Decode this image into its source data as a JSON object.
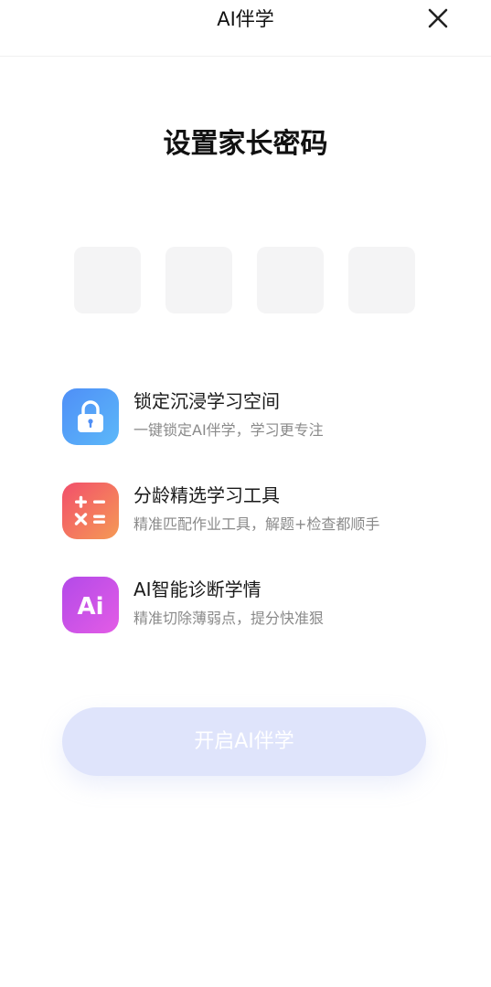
{
  "header": {
    "title": "AI伴学",
    "close_icon": "close-icon"
  },
  "page_title": "设置家长密码",
  "pin": {
    "length": 4,
    "filled": 0
  },
  "features": [
    {
      "icon": "lock-icon",
      "title": "锁定沉浸学习空间",
      "desc": "一键锁定AI伴学，学习更专注",
      "color": "#4f8ff7"
    },
    {
      "icon": "calculator-icon",
      "title": "分龄精选学习工具",
      "desc": "精准匹配作业工具，解题+检查都顺手",
      "color": "#f24f6b"
    },
    {
      "icon": "ai-icon",
      "icon_text": "Ai",
      "title": "AI智能诊断学情",
      "desc": "精准切除薄弱点，提分快准狠",
      "color": "#c24ee8"
    }
  ],
  "start_button": {
    "label": "开启AI伴学",
    "color": "#dfe4fb"
  }
}
